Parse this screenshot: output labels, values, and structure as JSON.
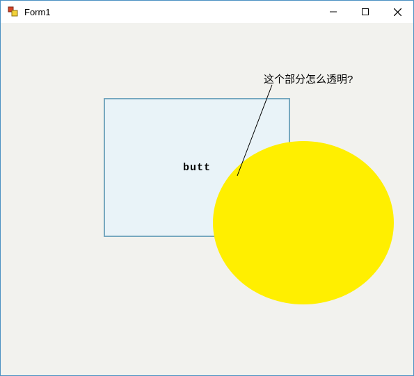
{
  "window": {
    "title": "Form1"
  },
  "panel": {
    "button_label": "butt"
  },
  "annotation": {
    "text": "这个部分怎么透明?"
  }
}
